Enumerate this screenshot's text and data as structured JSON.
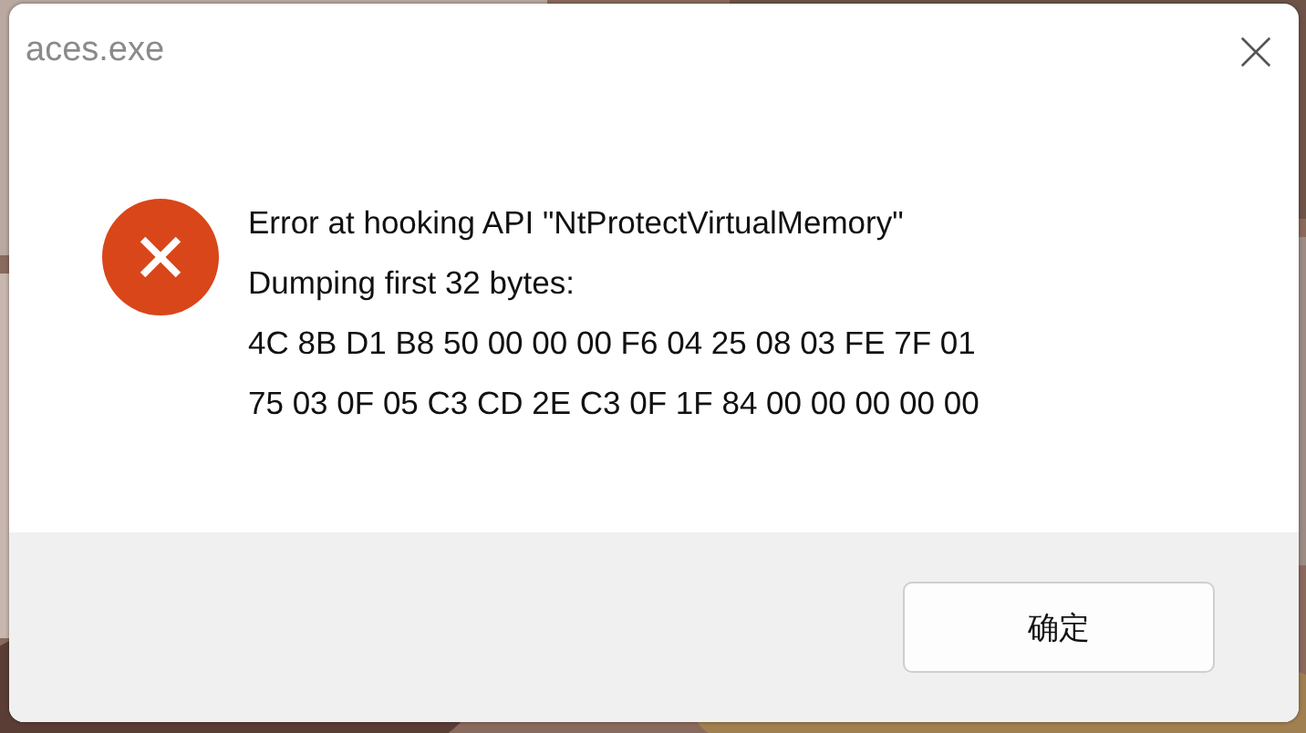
{
  "window": {
    "title": "aces.exe"
  },
  "message": {
    "kind": "error",
    "lines": [
      "Error at hooking API \"NtProtectVirtualMemory\"",
      "Dumping first 32 bytes:",
      "4C 8B D1 B8 50 00 00 00 F6 04 25 08 03 FE 7F 01",
      "75 03 0F 05 C3 CD 2E C3 0F 1F 84 00 00 00 00 00"
    ]
  },
  "buttons": [
    "确定"
  ]
}
